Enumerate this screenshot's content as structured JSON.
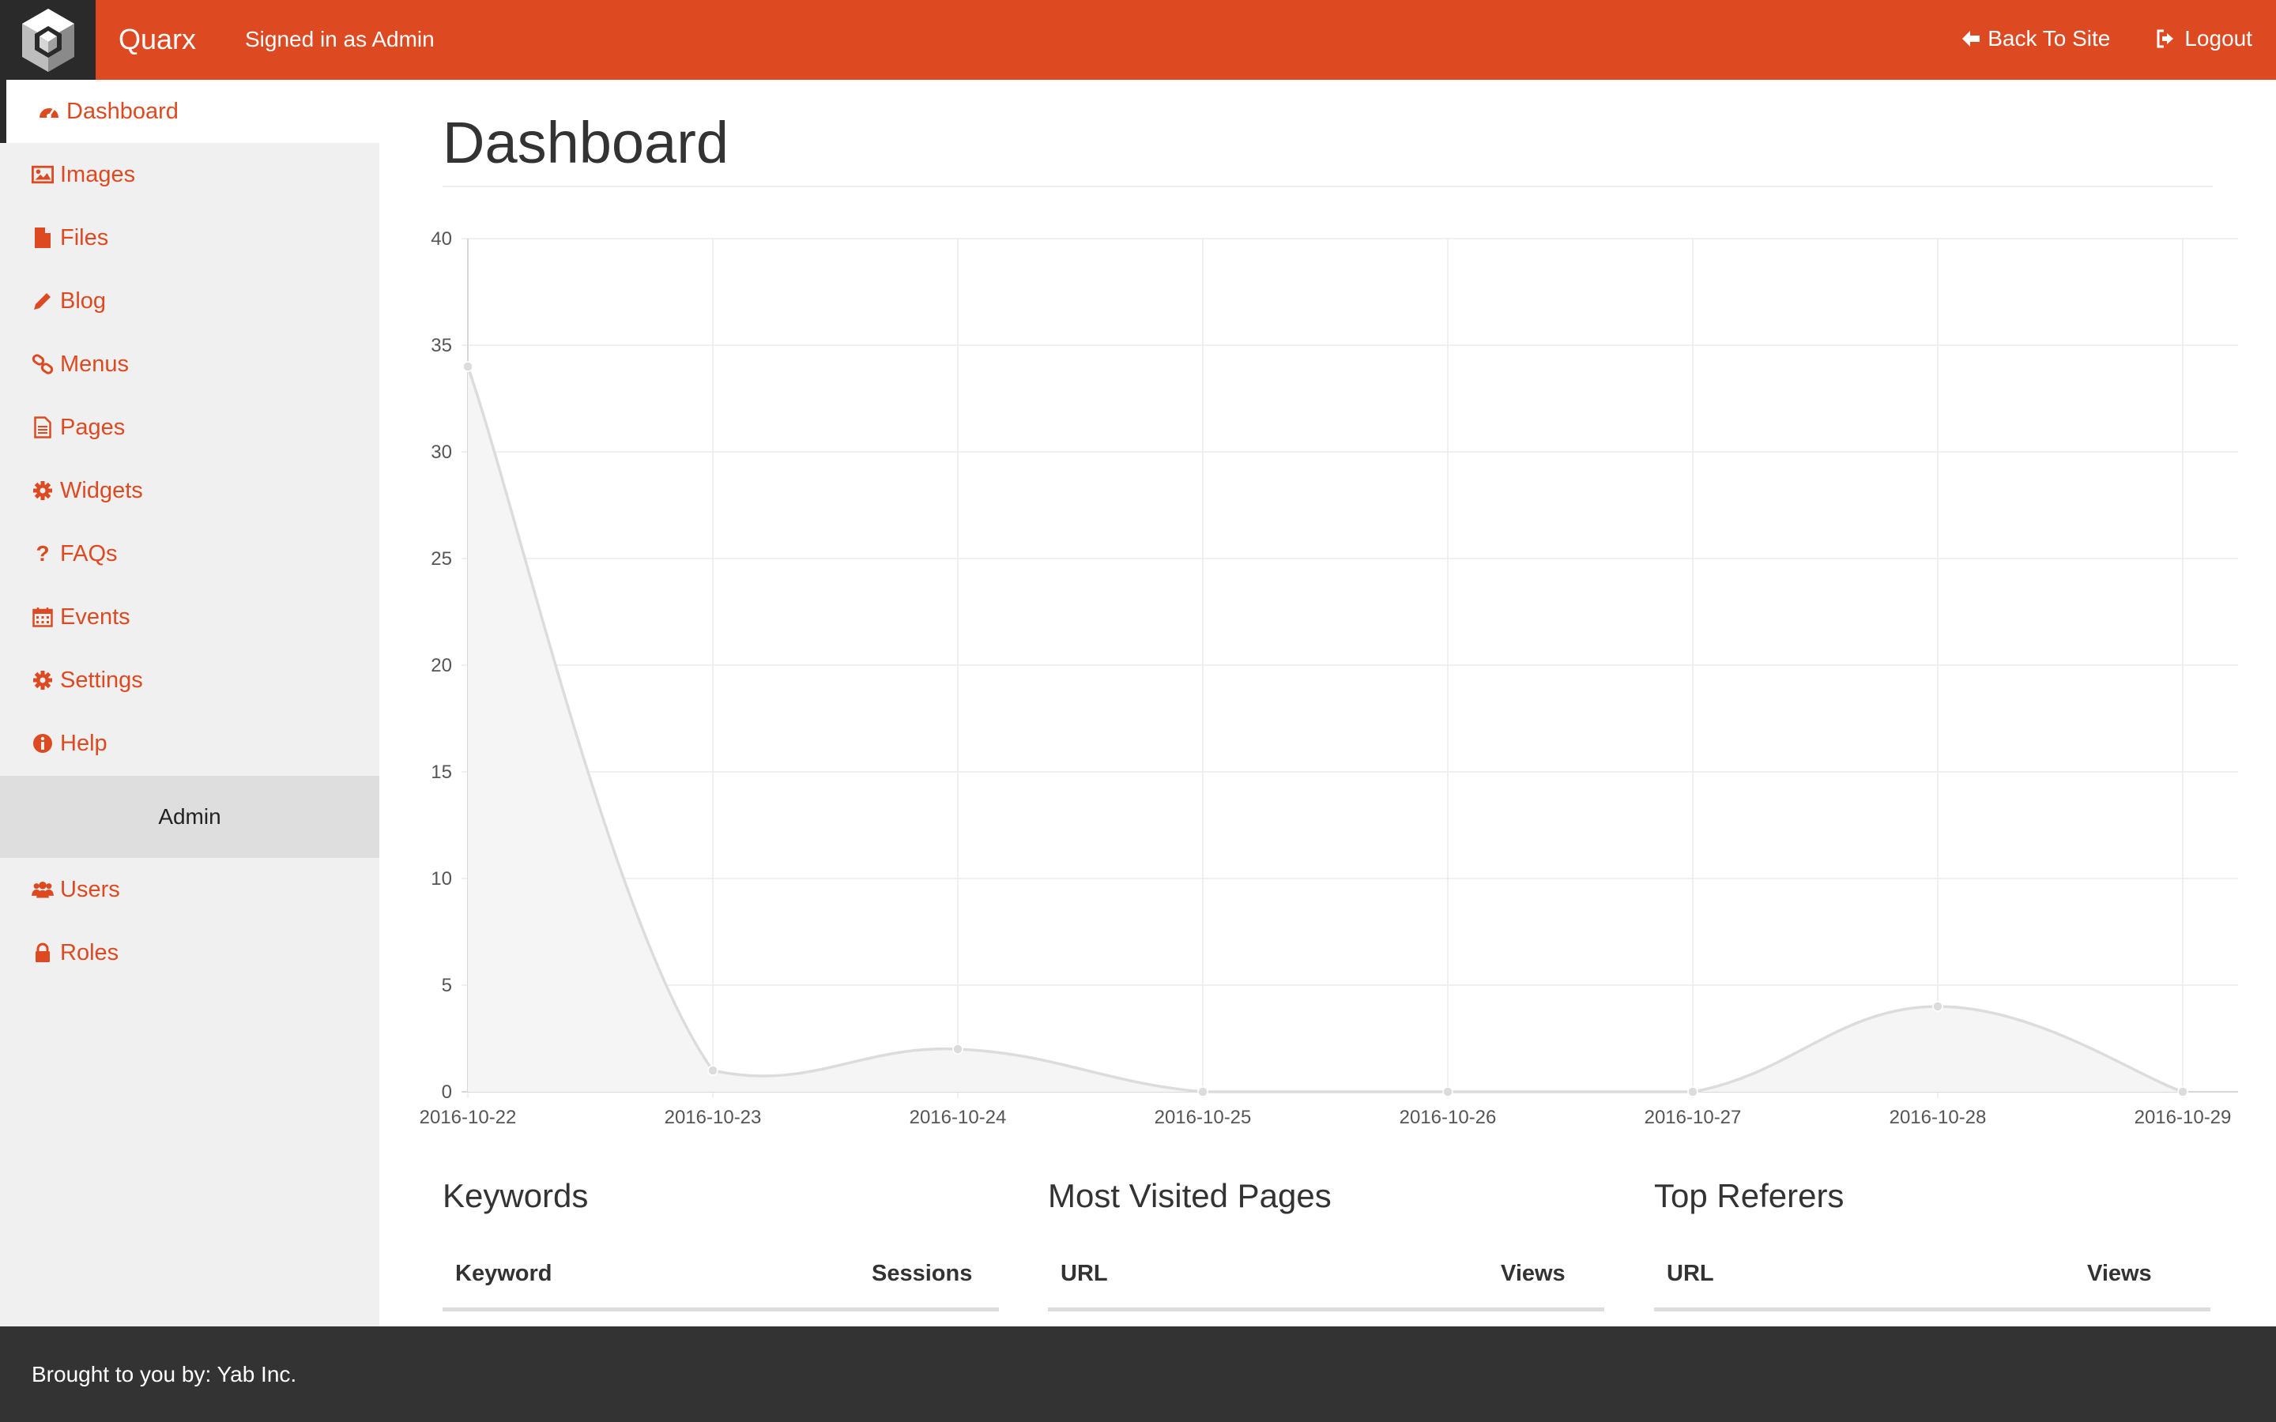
{
  "colors": {
    "accent": "#dd4a22",
    "dark": "#2a2a2a",
    "sidebar_bg": "#f0f0f0",
    "footer_bg": "#333333"
  },
  "navbar": {
    "brand": "Quarx",
    "signed_in": "Signed in as Admin",
    "back_to_site": "Back To Site",
    "logout": "Logout"
  },
  "sidebar": {
    "items": [
      {
        "label": "Dashboard",
        "icon": "dashboard-icon",
        "active": true
      },
      {
        "label": "Images",
        "icon": "image-icon"
      },
      {
        "label": "Files",
        "icon": "file-icon"
      },
      {
        "label": "Blog",
        "icon": "pencil-icon"
      },
      {
        "label": "Menus",
        "icon": "link-icon"
      },
      {
        "label": "Pages",
        "icon": "page-icon"
      },
      {
        "label": "Widgets",
        "icon": "gear-icon"
      },
      {
        "label": "FAQs",
        "icon": "question-icon"
      },
      {
        "label": "Events",
        "icon": "calendar-icon"
      },
      {
        "label": "Settings",
        "icon": "gear-icon"
      },
      {
        "label": "Help",
        "icon": "info-icon"
      }
    ],
    "section_label": "Admin",
    "admin_items": [
      {
        "label": "Users",
        "icon": "users-icon"
      },
      {
        "label": "Roles",
        "icon": "lock-icon"
      }
    ]
  },
  "main": {
    "title": "Dashboard"
  },
  "chart_data": {
    "type": "area",
    "x": [
      "2016-10-22",
      "2016-10-23",
      "2016-10-24",
      "2016-10-25",
      "2016-10-26",
      "2016-10-27",
      "2016-10-28",
      "2016-10-29"
    ],
    "series": [
      {
        "values": [
          34,
          1,
          2,
          0,
          0,
          0,
          4,
          0
        ]
      }
    ],
    "ylim": [
      0,
      40
    ],
    "yticks": [
      0,
      5,
      10,
      15,
      20,
      25,
      30,
      35,
      40
    ],
    "grid": true,
    "line_color": "#dcdcdc",
    "fill_color": "#f5f5f5"
  },
  "panels": [
    {
      "title": "Keywords",
      "col1": "Keyword",
      "col2": "Sessions"
    },
    {
      "title": "Most Visited Pages",
      "col1": "URL",
      "col2": "Views"
    },
    {
      "title": "Top Referers",
      "col1": "URL",
      "col2": "Views"
    }
  ],
  "footer": {
    "text": "Brought to you by: Yab Inc."
  }
}
